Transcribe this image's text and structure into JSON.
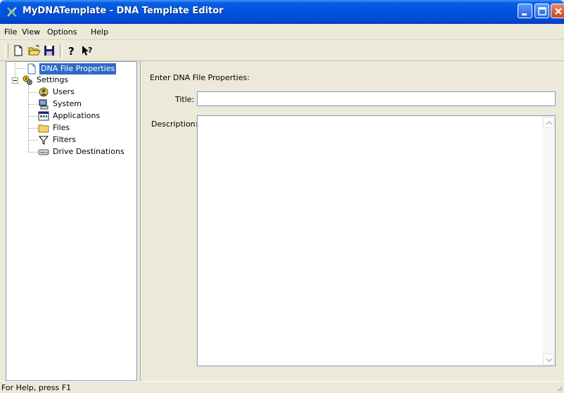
{
  "window": {
    "title": "MyDNATemplate - DNA Template Editor",
    "icon": "dna-app-icon",
    "controls": [
      "minimize-icon",
      "maximize-icon",
      "close-icon"
    ]
  },
  "menu": {
    "items": [
      "File",
      "View",
      "Options",
      "Help"
    ]
  },
  "toolbar": {
    "buttons": [
      "new-document-icon",
      "open-folder-icon",
      "save-disk-icon",
      "help-icon",
      "context-help-icon"
    ]
  },
  "tree": {
    "root": {
      "label": "DNA File Properties",
      "icon": "document-icon",
      "selected": true
    },
    "settings": {
      "label": "Settings",
      "icon": "settings-gears-icon",
      "expanded": true,
      "children": [
        {
          "label": "Users",
          "icon": "users-icon"
        },
        {
          "label": "System",
          "icon": "computer-icon"
        },
        {
          "label": "Applications",
          "icon": "applications-icon"
        },
        {
          "label": "Files",
          "icon": "folder-icon"
        },
        {
          "label": "Filters",
          "icon": "filter-funnel-icon"
        },
        {
          "label": "Drive Destinations",
          "icon": "drive-icon"
        }
      ]
    }
  },
  "form": {
    "heading": "Enter DNA File Properties:",
    "title_label": "Title:",
    "title_value": "",
    "description_label": "Description:",
    "description_value": ""
  },
  "status": {
    "text": "For Help, press F1"
  },
  "colors": {
    "titlebar": "#0053e1",
    "selection": "#316ac5",
    "chrome": "#ece9d8"
  }
}
